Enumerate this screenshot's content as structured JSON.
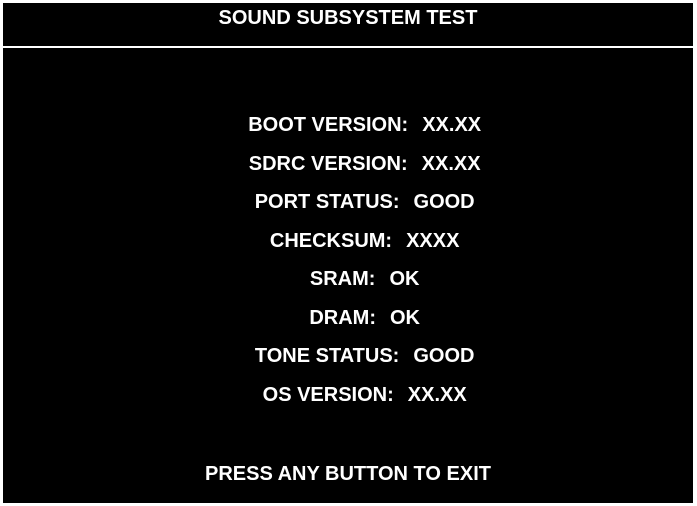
{
  "header": {
    "title": "SOUND SUBSYSTEM TEST"
  },
  "status": {
    "boot_version": {
      "label": "BOOT VERSION:",
      "value": "XX.XX"
    },
    "sdrc_version": {
      "label": "SDRC VERSION:",
      "value": "XX.XX"
    },
    "port_status": {
      "label": "PORT STATUS:",
      "value": "GOOD"
    },
    "checksum": {
      "label": "CHECKSUM:",
      "value": "XXXX"
    },
    "sram": {
      "label": "SRAM:",
      "value": "OK"
    },
    "dram": {
      "label": "DRAM:",
      "value": "OK"
    },
    "tone_status": {
      "label": "TONE STATUS:",
      "value": "GOOD"
    },
    "os_version": {
      "label": "OS VERSION:",
      "value": "XX.XX"
    }
  },
  "footer": {
    "prompt": "PRESS ANY BUTTON TO EXIT"
  },
  "colors": {
    "background": "#000000",
    "text": "#ffffff",
    "border": "#ffffff"
  }
}
